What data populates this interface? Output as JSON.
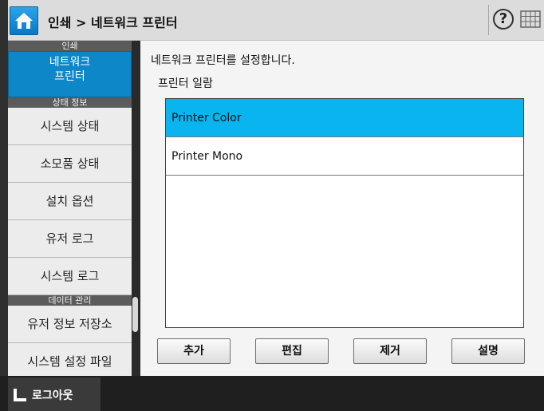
{
  "header": {
    "title": "인쇄 > 네트워크 프린터",
    "help_symbol": "?",
    "icons": [
      "home-icon",
      "help-icon",
      "keyboard-grid-icon"
    ]
  },
  "sidebar": {
    "group1_header": "인쇄",
    "active_item_line1": "네트워크",
    "active_item_line2": "프린터",
    "group2_header": "상태 정보",
    "items_status": [
      "시스템 상태",
      "소모품 상태",
      "설치 옵션",
      "유저 로그",
      "시스템 로그"
    ],
    "group3_header": "데이터 관리",
    "items_data": [
      "유저 정보 저장소",
      "시스템 설정 파일"
    ]
  },
  "main": {
    "description": "네트워크 프린터를 설정합니다.",
    "list_label": "프린터 일람",
    "printers": [
      "Printer Color",
      "Printer Mono"
    ],
    "selected_index": 0,
    "buttons": {
      "add": "추가",
      "edit": "편집",
      "remove": "제거",
      "description": "설명"
    }
  },
  "footer": {
    "logout_label": "로그아웃"
  },
  "colors": {
    "accent": "#0e87c8",
    "selected_row": "#0ab4ef",
    "topbar": "#dcdcdc",
    "background": "#2a2a2a"
  }
}
